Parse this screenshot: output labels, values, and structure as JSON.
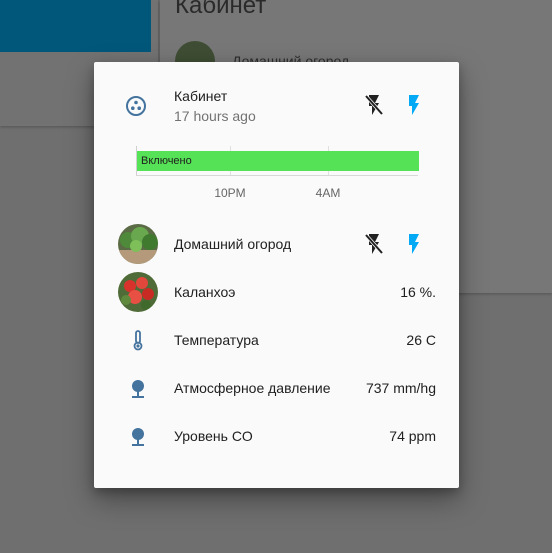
{
  "background": {
    "card_title": "Кабинет",
    "card_item": "Домашний огород"
  },
  "dialog": {
    "header": {
      "icon": "scatter-dots-icon",
      "name": "Кабинет",
      "last_changed": "17 hours ago",
      "actions": [
        {
          "icon": "flash-off-icon",
          "color": "#212121"
        },
        {
          "icon": "flash-icon",
          "color": "#03a9f4"
        }
      ]
    },
    "history": {
      "state_label": "Включено",
      "state_color": "#56e256",
      "ticks": [
        "10PM",
        "4AM"
      ]
    },
    "entities": [
      {
        "name": "Домашний огород",
        "value": "",
        "icon": "garden-photo",
        "has_toggle": true
      },
      {
        "name": "Каланхоэ",
        "value": "16 %.",
        "icon": "kalanchoe-photo"
      },
      {
        "name": "Температура",
        "value": "26 C",
        "icon": "thermometer-icon"
      },
      {
        "name": "Атмосферное давление",
        "value": "737 mm/hg",
        "icon": "gauge-pin-icon"
      },
      {
        "name": "Уровень CO",
        "value": "74 ppm",
        "icon": "gauge-pin-icon"
      }
    ],
    "colors": {
      "icon_default": "#44739e",
      "accent": "#03a9f4"
    }
  }
}
